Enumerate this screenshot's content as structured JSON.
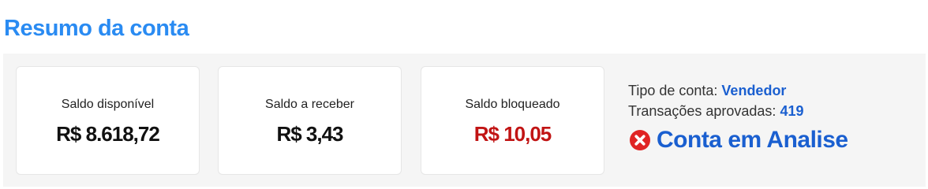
{
  "header": {
    "title": "Resumo da conta"
  },
  "cards": [
    {
      "label": "Saldo disponível",
      "value": "R$ 8.618,72"
    },
    {
      "label": "Saldo a receber",
      "value": "R$ 3,43"
    },
    {
      "label": "Saldo bloqueado",
      "value": "R$ 10,05"
    }
  ],
  "account": {
    "type_label": "Tipo de conta:",
    "type_value": "Vendedor",
    "approved_label": "Transações aprovadas:",
    "approved_value": "419",
    "status_icon": "error-circle-icon",
    "status_text": "Conta em Analise"
  },
  "colors": {
    "title": "#2a8bf2",
    "accent": "#1a5fd0",
    "blocked": "#c11414",
    "error_icon": "#e02424"
  }
}
